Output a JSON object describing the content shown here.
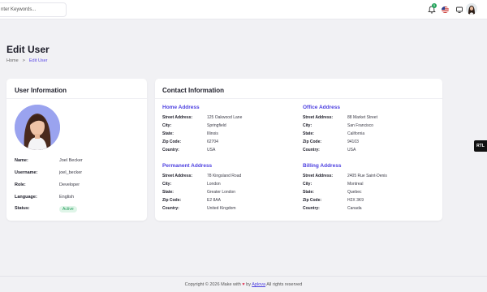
{
  "search": {
    "placeholder": "nter Keywords..."
  },
  "notifications": {
    "badge": "5"
  },
  "page": {
    "title": "Edit User"
  },
  "breadcrumb": {
    "home": "Home",
    "separator": ">",
    "current": "Edit User"
  },
  "user_card": {
    "title": "User Information",
    "rows": [
      {
        "label": "Name:",
        "value": "Joel Becker"
      },
      {
        "label": "Username:",
        "value": "joel_becker"
      },
      {
        "label": "Role:",
        "value": "Developer"
      },
      {
        "label": "Language:",
        "value": "English"
      },
      {
        "label": "Status:",
        "value": "Active"
      }
    ]
  },
  "contact_card": {
    "title": "Contact Information",
    "addresses": [
      {
        "heading": "Home Address",
        "rows": [
          {
            "label": "Street Address:",
            "value": "125 Oakwood Lane"
          },
          {
            "label": "City:",
            "value": "Springfield"
          },
          {
            "label": "State:",
            "value": "Illinois"
          },
          {
            "label": "Zip Code:",
            "value": "62704"
          },
          {
            "label": "Country:",
            "value": "USA"
          }
        ]
      },
      {
        "heading": "Office Address",
        "rows": [
          {
            "label": "Street Address:",
            "value": "88 Market Street"
          },
          {
            "label": "City:",
            "value": "San Francisco"
          },
          {
            "label": "State:",
            "value": "California"
          },
          {
            "label": "Zip Code:",
            "value": "94103"
          },
          {
            "label": "Country:",
            "value": "USA"
          }
        ]
      },
      {
        "heading": "Permanent Address",
        "rows": [
          {
            "label": "Street Address:",
            "value": "78 Kingsland Road"
          },
          {
            "label": "City:",
            "value": "London"
          },
          {
            "label": "State:",
            "value": "Greater London"
          },
          {
            "label": "Zip Code:",
            "value": "E2 8AA"
          },
          {
            "label": "Country:",
            "value": "United Kingdom"
          }
        ]
      },
      {
        "heading": "Billing Address",
        "rows": [
          {
            "label": "Street Address:",
            "value": "2405 Rue Saint-Denis"
          },
          {
            "label": "City:",
            "value": "Montreal"
          },
          {
            "label": "State:",
            "value": "Quebec"
          },
          {
            "label": "Zip Code:",
            "value": "H2X 3K9"
          },
          {
            "label": "Country:",
            "value": "Canada"
          }
        ]
      }
    ]
  },
  "rtl_toggle": {
    "label": "RTL"
  },
  "footer": {
    "prefix": "Copyright © 2026 Make with",
    "heart": "♥",
    "by": "by",
    "brand": "Aplova",
    "suffix": "All rights reserved"
  },
  "colors": {
    "accent": "#4c3fe0",
    "status_active": "#1f9a57",
    "heart": "#e03b5a"
  },
  "icons": [
    "bell-icon",
    "us-flag-icon",
    "monitor-icon",
    "user-avatar"
  ]
}
